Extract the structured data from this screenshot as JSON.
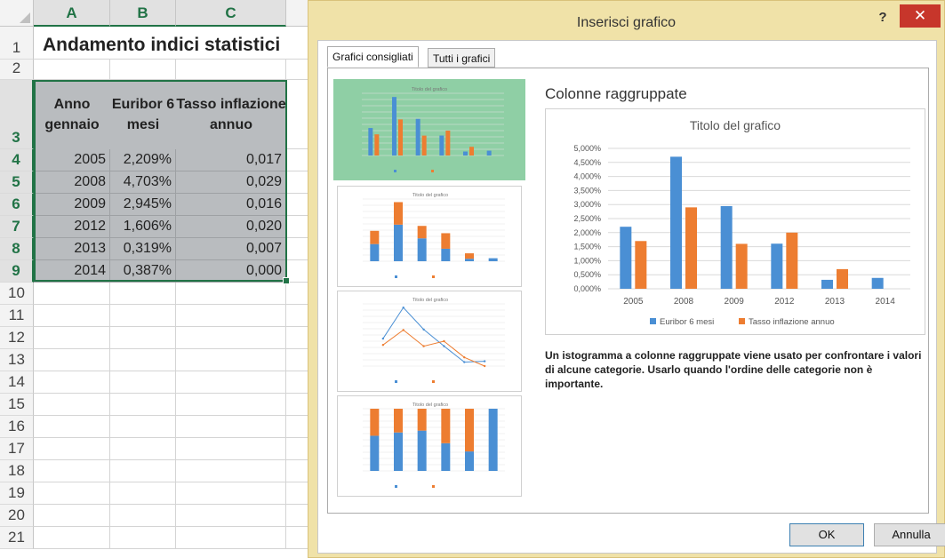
{
  "spreadsheet": {
    "columns": [
      "A",
      "B",
      "C"
    ],
    "row_numbers": [
      "1",
      "2",
      "3",
      "4",
      "5",
      "6",
      "7",
      "8",
      "9",
      "10",
      "11",
      "12",
      "13",
      "14",
      "15",
      "16",
      "17",
      "18",
      "19",
      "20",
      "21"
    ],
    "title": "Andamento indici statistici",
    "headers": {
      "anno": "Anno gennaio",
      "euribor": "Euribor 6 mesi",
      "tasso": "Tasso inflazione annuo"
    },
    "rows": [
      {
        "anno": "2005",
        "euribor": "2,209%",
        "tasso": "0,017"
      },
      {
        "anno": "2008",
        "euribor": "4,703%",
        "tasso": "0,029"
      },
      {
        "anno": "2009",
        "euribor": "2,945%",
        "tasso": "0,016"
      },
      {
        "anno": "2012",
        "euribor": "1,606%",
        "tasso": "0,020"
      },
      {
        "anno": "2013",
        "euribor": "0,319%",
        "tasso": "0,007"
      },
      {
        "anno": "2014",
        "euribor": "0,387%",
        "tasso": "0,000"
      }
    ]
  },
  "dialog": {
    "title": "Inserisci grafico",
    "help_label": "?",
    "close_label": "✕",
    "tabs": [
      "Grafici consigliati",
      "Tutti i grafici"
    ],
    "active_tab": "Grafici consigliati",
    "preview_title": "Colonne raggruppate",
    "description": "Un istogramma a colonne raggruppate viene usato per confrontare i valori di alcune categorie. Usarlo quando l'ordine delle categorie non è importante.",
    "ok_label": "OK",
    "cancel_label": "Annulla",
    "colors": {
      "series1": "#4a8fd4",
      "series2": "#ed7d31",
      "selected_thumb": "#8fcfa5",
      "close_red": "#c7362b"
    }
  },
  "chart_data": {
    "type": "bar",
    "title": "Titolo del grafico",
    "categories": [
      "2005",
      "2008",
      "2009",
      "2012",
      "2013",
      "2014"
    ],
    "series": [
      {
        "name": "Euribor 6 mesi",
        "values": [
          2.209,
          4.703,
          2.945,
          1.606,
          0.319,
          0.387
        ]
      },
      {
        "name": "Tasso inflazione annuo",
        "values": [
          1.7,
          2.9,
          1.6,
          2.0,
          0.7,
          0.0
        ]
      }
    ],
    "yticks": [
      "0,000%",
      "0,500%",
      "1,000%",
      "1,500%",
      "2,000%",
      "2,500%",
      "3,000%",
      "3,500%",
      "4,000%",
      "4,500%",
      "5,000%"
    ],
    "ylim": [
      0,
      5
    ],
    "grid": true,
    "legend": "bottom"
  }
}
